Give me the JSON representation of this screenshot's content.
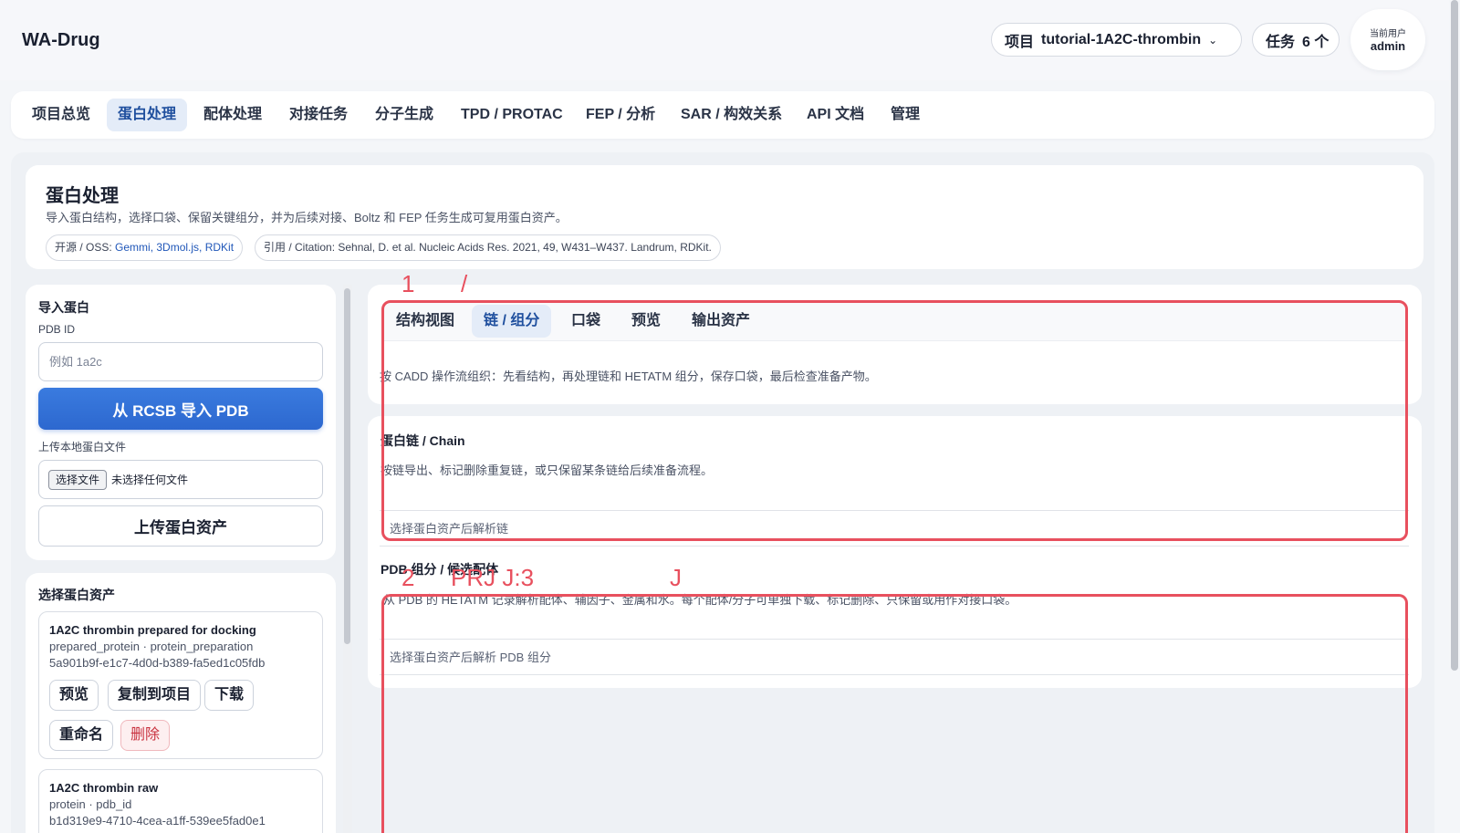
{
  "app": {
    "brand": "WA-Drug"
  },
  "header": {
    "project_label": "项目",
    "project_value": "tutorial-1A2C-thrombin",
    "tasks_label": "任务",
    "tasks_count": "6 个",
    "user_caption": "当前用户",
    "user_name": "admin"
  },
  "nav": {
    "items": [
      "项目总览",
      "蛋白处理",
      "配体处理",
      "对接任务",
      "分子生成",
      "TPD / PROTAC",
      "FEP / 分析",
      "SAR / 构效关系",
      "API 文档",
      "管理"
    ],
    "active": "蛋白处理"
  },
  "intro": {
    "title": "蛋白处理",
    "description": "导入蛋白结构，选择口袋、保留关键组分，并为后续对接、Boltz 和 FEP 任务生成可复用蛋白资产。",
    "oss_prefix": "开源 / OSS:",
    "oss_links": "Gemmi, 3Dmol.js, RDKit",
    "citation": "引用 / Citation: Sehnal, D. et al. Nucleic Acids Res. 2021, 49, W431–W437. Landrum, RDKit."
  },
  "import_panel": {
    "title": "导入蛋白",
    "pdb_label": "PDB ID",
    "pdb_placeholder": "例如 1a2c",
    "import_button": "从 RCSB 导入 PDB",
    "upload_label": "上传本地蛋白文件",
    "file_button": "选择文件",
    "file_status": "未选择任何文件",
    "upload_button": "上传蛋白资产"
  },
  "assets_panel": {
    "title": "选择蛋白资产",
    "assets": [
      {
        "name": "1A2C thrombin prepared for docking",
        "type": "prepared_protein · protein_preparation",
        "id": "5a901b9f-e1c7-4d0d-b389-fa5ed1c05fdb",
        "actions": [
          "预览",
          "复制到项目",
          "下载",
          "重命名",
          "删除"
        ]
      },
      {
        "name": "1A2C thrombin raw",
        "type": "protein · pdb_id",
        "id": "b1d319e9-4710-4cea-a1ff-539ee5fad0e1"
      }
    ]
  },
  "workspace": {
    "tabs": [
      "结构视图",
      "链 / 组分",
      "口袋",
      "预览",
      "输出资产"
    ],
    "active_tab": "链 / 组分",
    "flow_text": "按 CADD 操作流组织：先看结构，再处理链和 HETATM 组分，保存口袋，最后检查准备产物。",
    "chain_title": "蛋白链 / Chain",
    "chain_desc": "按链导出、标记删除重复链，或只保留某条链给后续准备流程。",
    "chain_empty": "选择蛋白资产后解析链",
    "hetatm_title": "PDB 组分 / 候选配体",
    "hetatm_desc": "从 PDB 的 HETATM 记录解析配体、辅因子、金属和水。每个配体/分子可单独下载、标记删除、只保留或用作对接口袋。",
    "hetatm_empty": "选择蛋白资产后解析 PDB 组分"
  },
  "annotations": {
    "label_1": "1",
    "label_slash": "/",
    "label_2": "2",
    "label_prj": "PRJ J:3",
    "label_j": "J",
    "color": "#e8505e"
  }
}
